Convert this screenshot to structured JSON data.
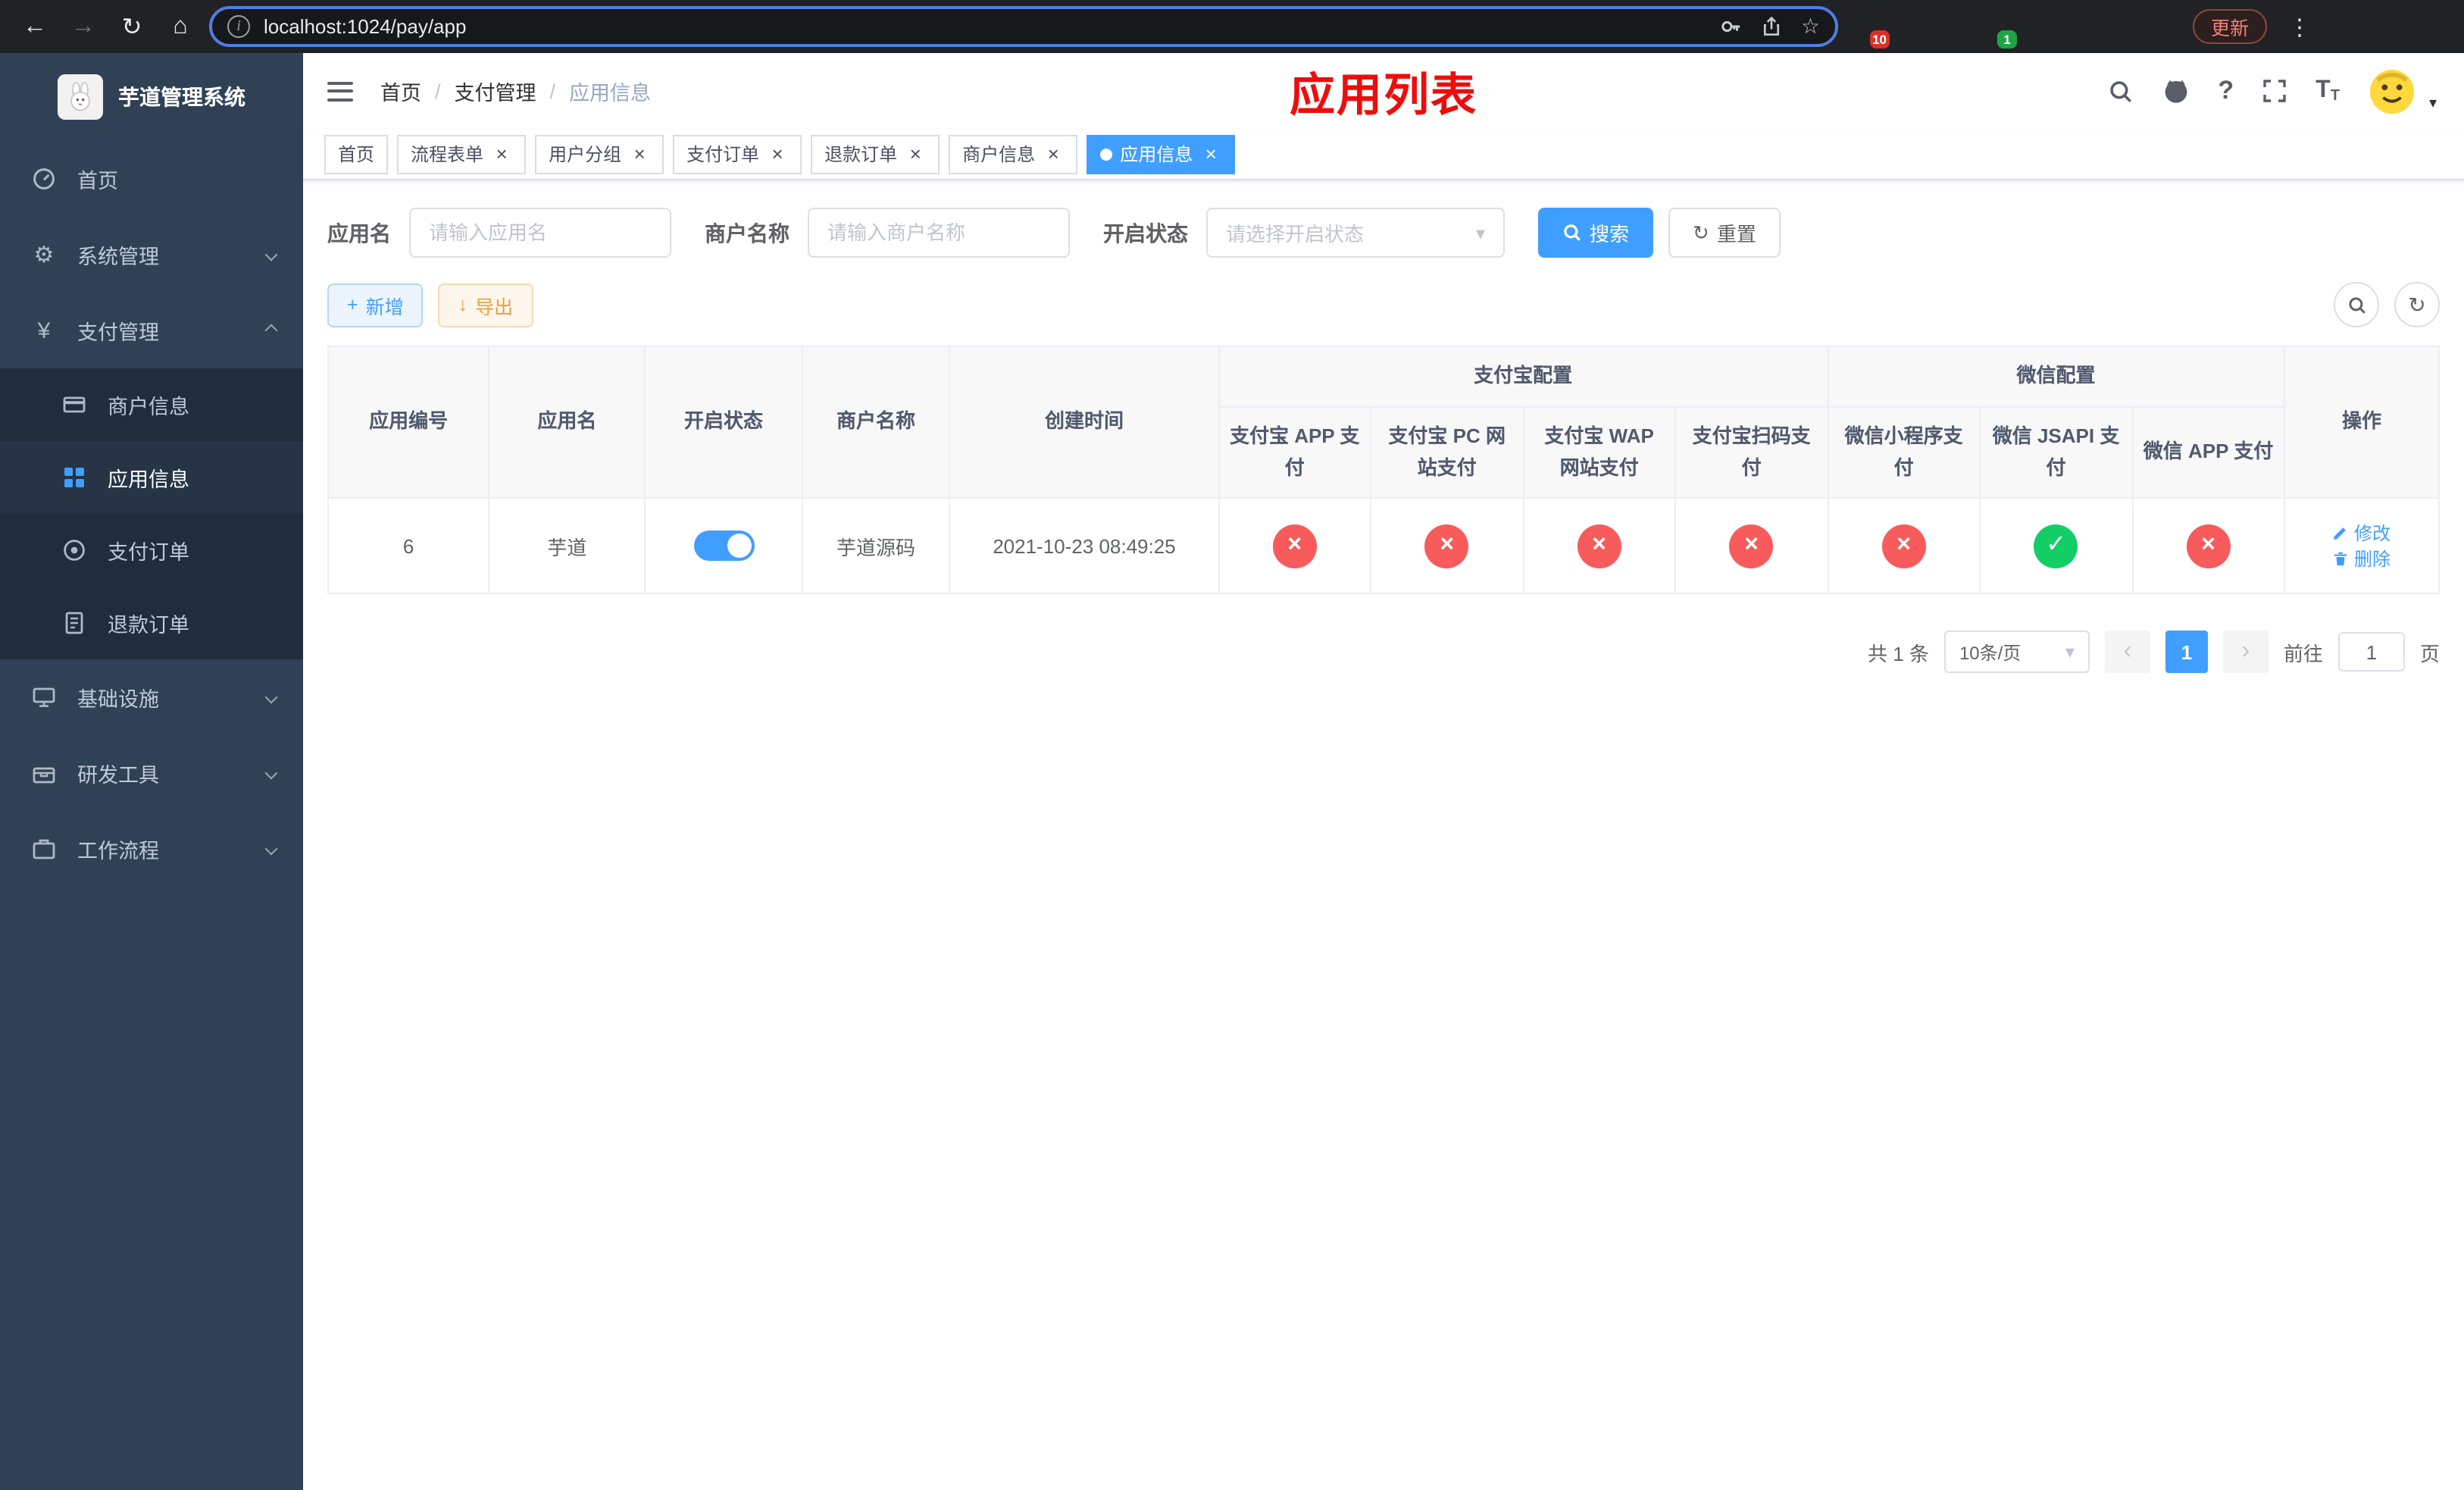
{
  "colors": {
    "primary": "#409eff",
    "danger": "#f75b5b",
    "success": "#13ce66",
    "annotation": "#ee0d0d",
    "sidebar-bg": "#304156",
    "sidebar-sub-bg": "#1f2d3d"
  },
  "icons": {
    "back": "←",
    "forward": "→",
    "reload": "↻",
    "home": "⌂",
    "info": "i",
    "star": "☆",
    "dots": "⋮",
    "close": "×",
    "check": "✓",
    "cross": "×",
    "chevron_down": "▾",
    "plus": "+",
    "download": "↓",
    "refresh": "↻",
    "question": "?",
    "prev": "‹",
    "next": "›",
    "yen": "¥",
    "gear": "⚙",
    "caret": "▾",
    "separator": "/",
    "size_big": "T",
    "size_small": "T"
  },
  "browser": {
    "url": "localhost:1024/pay/app",
    "update_button": "更新",
    "extension_badge_count": "10",
    "profile_badge_count": "1"
  },
  "sidebar": {
    "logo_title": "芋道管理系统",
    "home": "首页",
    "system": "系统管理",
    "payment": "支付管理",
    "merchant_info": "商户信息",
    "app_info": "应用信息",
    "pay_order": "支付订单",
    "refund_order": "退款订单",
    "infra": "基础设施",
    "dev_tools": "研发工具",
    "workflow": "工作流程"
  },
  "header": {
    "breadcrumb": [
      "首页",
      "支付管理",
      "应用信息"
    ],
    "annotation": "应用列表"
  },
  "tabs": [
    {
      "label": "首页"
    },
    {
      "label": "流程表单"
    },
    {
      "label": "用户分组"
    },
    {
      "label": "支付订单"
    },
    {
      "label": "退款订单"
    },
    {
      "label": "商户信息"
    },
    {
      "label": "应用信息"
    }
  ],
  "filters": {
    "app_name_label": "应用名",
    "app_name_placeholder": "请输入应用名",
    "merchant_label": "商户名称",
    "merchant_placeholder": "请输入商户名称",
    "status_label": "开启状态",
    "status_placeholder": "请选择开启状态",
    "search_label": "搜索",
    "reset_label": "重置"
  },
  "toolbar": {
    "add_label": "新增",
    "export_label": "导出"
  },
  "table": {
    "group_headers": {
      "alipay": "支付宝配置",
      "wechat": "微信配置"
    },
    "columns": {
      "id": "应用编号",
      "name": "应用名",
      "status": "开启状态",
      "merchant": "商户名称",
      "created": "创建时间",
      "alipay_app": "支付宝 APP 支付",
      "alipay_pc": "支付宝 PC 网站支付",
      "alipay_wap": "支付宝 WAP 网站支付",
      "alipay_qr": "支付宝扫码支付",
      "wx_lite": "微信小程序支付",
      "wx_jsapi": "微信 JSAPI 支付",
      "wx_app": "微信 APP 支付",
      "actions": "操作"
    },
    "rows": [
      {
        "id": "6",
        "name": "芋道",
        "enabled": true,
        "merchant": "芋道源码",
        "created": "2021-10-23 08:49:25",
        "alipay_app": false,
        "alipay_pc": false,
        "alipay_wap": false,
        "alipay_qr": false,
        "wx_lite": false,
        "wx_jsapi": true,
        "wx_app": false,
        "edit_label": "修改",
        "delete_label": "删除"
      }
    ]
  },
  "pagination": {
    "total": "共 1 条",
    "page_size": "10条/页",
    "current_page": "1",
    "goto_label": "前往",
    "goto_value": "1",
    "page_unit": "页"
  }
}
